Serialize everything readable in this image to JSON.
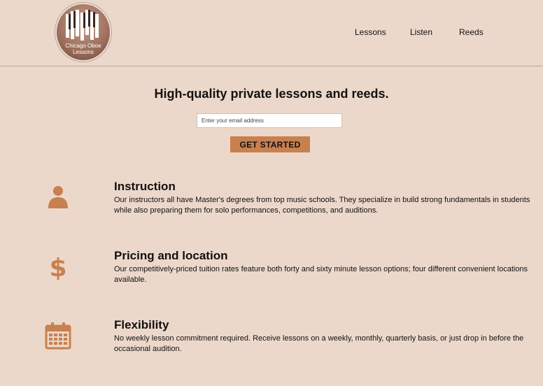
{
  "brand": {
    "logo_line1": "Chicago Oboe",
    "logo_line2": "Lessons"
  },
  "nav": {
    "items": [
      {
        "label": "Lessons"
      },
      {
        "label": "Listen"
      },
      {
        "label": "Reeds"
      }
    ]
  },
  "hero": {
    "title": "High-quality private lessons and reeds.",
    "email_placeholder": "Enter your email address",
    "cta_label": "GET STARTED"
  },
  "features": [
    {
      "icon": "person-icon",
      "title": "Instruction",
      "text": "Our instructors all have Master's degrees from top music schools. They specialize in build strong fundamentals in students while also preparing them for solo performances, competitions, and auditions."
    },
    {
      "icon": "dollar-icon",
      "title": "Pricing and location",
      "text": "Our competitively-priced tuition rates feature both forty and sixty minute lesson options; four different convenient locations available."
    },
    {
      "icon": "calendar-icon",
      "title": "Flexibility",
      "text": "No weekly lesson commitment required. Receive lessons on a weekly, monthly, quarterly basis, or just drop in before the occasional audition."
    }
  ],
  "colors": {
    "background": "#ecd8ca",
    "accent": "#c8804f",
    "icon": "#c8804f"
  }
}
